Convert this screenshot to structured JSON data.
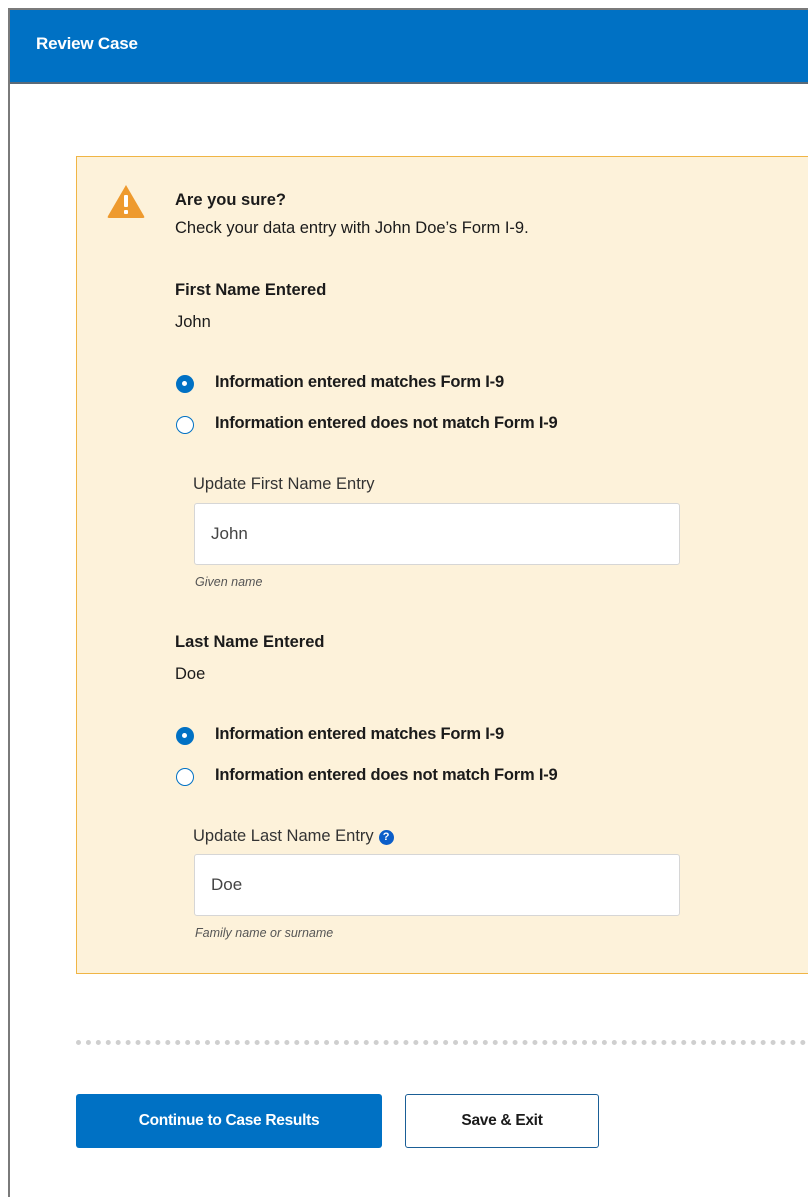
{
  "header": {
    "title": "Review Case"
  },
  "alert": {
    "icon": "warning-triangle-icon",
    "title": "Are you sure?",
    "message": "Check your data entry with John Doe’s Form I-9.",
    "first_name": {
      "heading": "First Name Entered",
      "value": "John",
      "options": [
        {
          "label": "Information entered matches Form I-9",
          "checked": true
        },
        {
          "label": "Information entered does not match Form I-9",
          "checked": false
        }
      ],
      "update_label": "Update First Name Entry",
      "input_value": "John",
      "hint": "Given name"
    },
    "last_name": {
      "heading": "Last Name Entered",
      "value": "Doe",
      "options": [
        {
          "label": "Information entered matches Form I-9",
          "checked": true
        },
        {
          "label": "Information entered does not match Form I-9",
          "checked": false
        }
      ],
      "update_label": "Update Last Name Entry",
      "help_icon": "question-circle-icon",
      "input_value": "Doe",
      "hint": "Family name or surname"
    }
  },
  "actions": {
    "continue_label": "Continue to Case Results",
    "save_label": "Save & Exit"
  },
  "colors": {
    "primary": "#0071c4",
    "alert_bg": "#fdf2da",
    "alert_border": "#f0b545",
    "warning": "#ee9a2e"
  }
}
